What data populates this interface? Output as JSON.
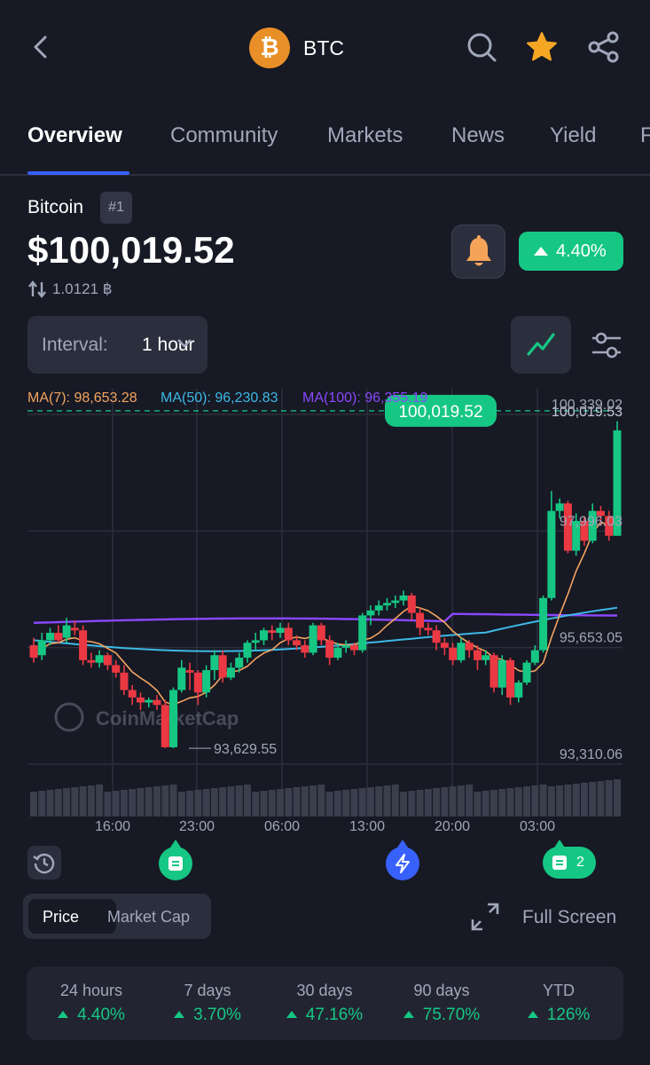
{
  "header": {
    "symbol": "BTC",
    "icons": [
      "back-arrow-icon",
      "bitcoin-logo-icon",
      "search-icon",
      "star-icon",
      "share-icon"
    ]
  },
  "tabs": [
    "Overview",
    "Community",
    "Markets",
    "News",
    "Yield",
    "F"
  ],
  "coin": {
    "name": "Bitcoin",
    "rank": "#1",
    "price": "$100,019.52",
    "btc_equivalent": "1.0121 ฿",
    "change_24h": "4.40%"
  },
  "controls": {
    "interval_label": "Interval:",
    "interval_value": "1 hour"
  },
  "moving_averages": {
    "ma7": "MA(7): 98,653.28",
    "ma50": "MA(50): 96,230.83",
    "ma100": "MA(100): 96,355.19"
  },
  "chart_labels": {
    "current_price": "100,019.52",
    "current_axis": "100,019.53",
    "low_marker": "93,629.55",
    "watermark": "CoinMarketCap",
    "y_ticks": [
      "100,339.02",
      "97,996.03",
      "95,653.05",
      "93,310.06"
    ],
    "x_ticks": [
      "16:00",
      "23:00",
      "06:00",
      "13:00",
      "20:00",
      "03:00"
    ]
  },
  "timeline": {
    "notes_count": "2"
  },
  "toggle": {
    "price": "Price",
    "market_cap": "Market Cap"
  },
  "full_screen_label": "Full Screen",
  "performance": [
    {
      "label": "24 hours",
      "value": "4.40%"
    },
    {
      "label": "7 days",
      "value": "3.70%"
    },
    {
      "label": "30 days",
      "value": "47.16%"
    },
    {
      "label": "90 days",
      "value": "75.70%"
    },
    {
      "label": "YTD",
      "value": "126%"
    }
  ],
  "colors": {
    "background": "#171924",
    "up": "#16c784",
    "down": "#ea3943",
    "accent": "#3861fb",
    "ma7": "#f4a460",
    "ma50": "#3db9e6",
    "ma100": "#8b48ff",
    "star": "#f5a623",
    "bell": "#f6a35a"
  },
  "chart_data": {
    "type": "candlestick",
    "y_ticks": [
      100339.02,
      97996.03,
      95653.05,
      93310.06
    ],
    "x_ticks": [
      "16:00",
      "23:00",
      "06:00",
      "13:00",
      "20:00",
      "03:00"
    ],
    "current_price": 100019.52,
    "low": 93629.55,
    "candles": [
      [
        95700,
        95450,
        95850,
        95350
      ],
      [
        95500,
        95800,
        95950,
        95400
      ],
      [
        95800,
        95950,
        96050,
        95700
      ],
      [
        95950,
        95800,
        96100,
        95750
      ],
      [
        95850,
        96100,
        96250,
        95750
      ],
      [
        96050,
        96000,
        96200,
        95900
      ],
      [
        96000,
        95400,
        96100,
        95300
      ],
      [
        95400,
        95350,
        95550,
        95250
      ],
      [
        95350,
        95500,
        95600,
        95250
      ],
      [
        95500,
        95300,
        95550,
        95200
      ],
      [
        95300,
        95150,
        95400,
        95050
      ],
      [
        95150,
        94800,
        95300,
        94700
      ],
      [
        94800,
        94650,
        94900,
        94500
      ],
      [
        94650,
        94550,
        94750,
        94400
      ],
      [
        94550,
        94600,
        94650,
        94450
      ],
      [
        94600,
        94500,
        94700,
        94400
      ],
      [
        94500,
        93650,
        94600,
        93630
      ],
      [
        93650,
        94800,
        94850,
        93630
      ],
      [
        94800,
        95250,
        95400,
        94750
      ],
      [
        95200,
        95150,
        95350,
        94800
      ],
      [
        95150,
        94750,
        95200,
        94500
      ],
      [
        94750,
        95200,
        95300,
        94650
      ],
      [
        95200,
        95500,
        95600,
        95000
      ],
      [
        95500,
        95050,
        95600,
        94950
      ],
      [
        95050,
        95250,
        95350,
        95000
      ],
      [
        95250,
        95450,
        95550,
        95150
      ],
      [
        95450,
        95750,
        95800,
        95350
      ],
      [
        95750,
        95800,
        95950,
        95600
      ],
      [
        95800,
        96000,
        96050,
        95700
      ],
      [
        96000,
        95950,
        96100,
        95800
      ],
      [
        95950,
        96050,
        96150,
        95850
      ],
      [
        96050,
        95800,
        96150,
        95700
      ],
      [
        95800,
        95700,
        95900,
        95600
      ],
      [
        95700,
        95550,
        95800,
        95450
      ],
      [
        95550,
        96100,
        96150,
        95500
      ],
      [
        96100,
        95800,
        96150,
        95700
      ],
      [
        95800,
        95450,
        95900,
        95300
      ],
      [
        95450,
        95650,
        95750,
        95400
      ],
      [
        95650,
        95700,
        95800,
        95550
      ],
      [
        95700,
        95600,
        95750,
        95500
      ],
      [
        95600,
        96300,
        96350,
        95550
      ],
      [
        96300,
        96400,
        96500,
        96100
      ],
      [
        96400,
        96500,
        96600,
        96300
      ],
      [
        96500,
        96550,
        96650,
        96400
      ],
      [
        96550,
        96600,
        96700,
        96450
      ],
      [
        96600,
        96700,
        96800,
        96500
      ],
      [
        96700,
        96350,
        96750,
        96200
      ],
      [
        96350,
        96050,
        96450,
        95900
      ],
      [
        96050,
        96000,
        96150,
        95900
      ],
      [
        96000,
        95750,
        96100,
        95600
      ],
      [
        95750,
        95650,
        95850,
        95500
      ],
      [
        95650,
        95400,
        95750,
        95300
      ],
      [
        95400,
        95750,
        95850,
        95350
      ],
      [
        95750,
        95600,
        95800,
        95450
      ],
      [
        95600,
        95400,
        95700,
        95200
      ],
      [
        95400,
        95500,
        95600,
        95300
      ],
      [
        95500,
        94850,
        95550,
        94750
      ],
      [
        94850,
        95400,
        95500,
        94700
      ],
      [
        95400,
        94650,
        95450,
        94500
      ],
      [
        94650,
        94950,
        95000,
        94550
      ],
      [
        94950,
        95350,
        95400,
        94900
      ],
      [
        95350,
        95600,
        95700,
        95300
      ],
      [
        95600,
        96650,
        96700,
        95550
      ],
      [
        96650,
        98400,
        98800,
        96600
      ],
      [
        98400,
        98550,
        98650,
        98250
      ],
      [
        98550,
        97600,
        98600,
        97550
      ],
      [
        97600,
        98200,
        98350,
        97500
      ],
      [
        98200,
        97800,
        98300,
        97700
      ],
      [
        97800,
        98400,
        98550,
        97750
      ],
      [
        98400,
        98300,
        98500,
        98100
      ],
      [
        98300,
        97900,
        98400,
        97800
      ],
      [
        97900,
        100019.52,
        100200,
        97900
      ]
    ]
  }
}
